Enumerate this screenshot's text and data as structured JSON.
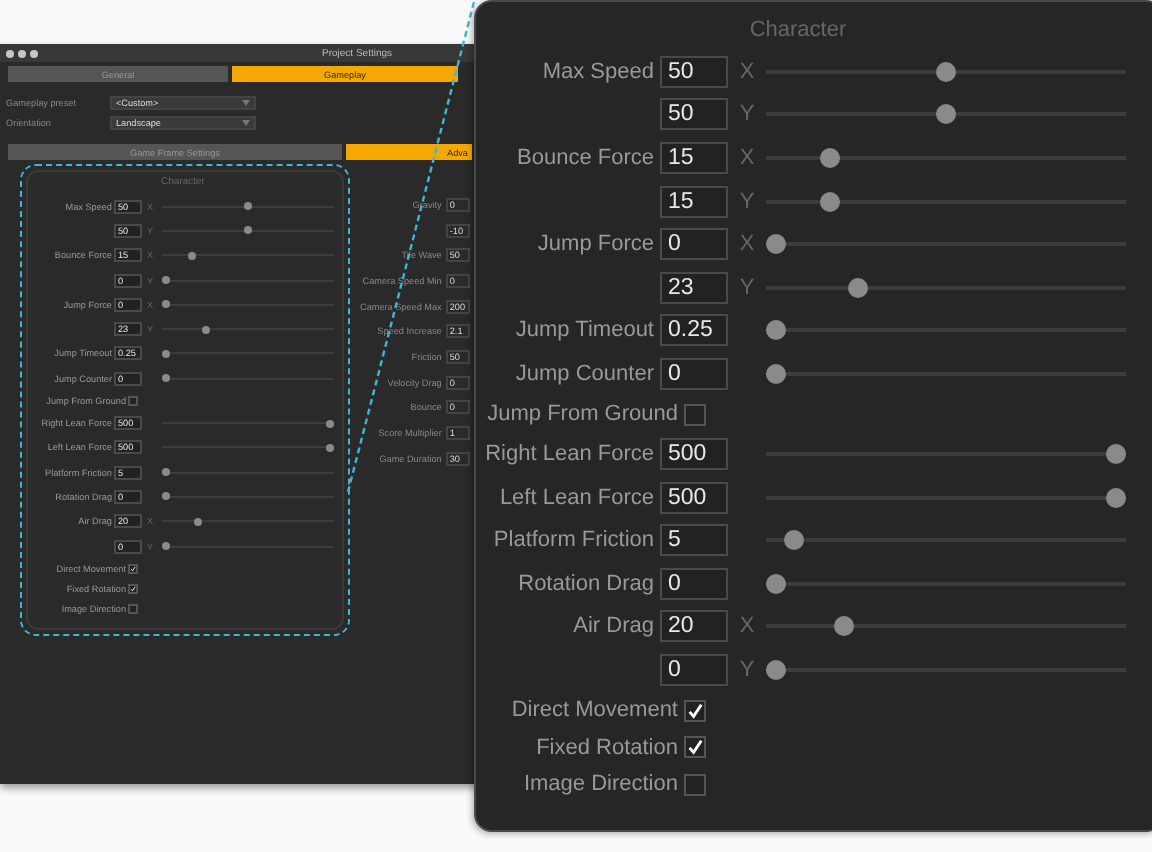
{
  "background_window": {
    "title": "Project Settings",
    "tabs": [
      {
        "label": "General",
        "selected": false
      },
      {
        "label": "Gameplay",
        "selected": true
      }
    ],
    "fields": [
      {
        "label": "Gameplay preset",
        "value": "<Custom>"
      },
      {
        "label": "Orientation",
        "value": "Landscape"
      }
    ],
    "section_tabs": [
      {
        "label": "Game Frame Settings",
        "selected": false
      },
      {
        "label": "Adva",
        "selected": true
      }
    ],
    "character_panel": {
      "title": "Character",
      "rows": [
        {
          "kind": "slider",
          "label": "Max Speed",
          "value": "50",
          "axis": "X",
          "level": 0.5
        },
        {
          "kind": "slider",
          "value": "50",
          "axis": "Y",
          "level": 0.5
        },
        {
          "kind": "slider",
          "label": "Bounce Force",
          "value": "15",
          "axis": "X",
          "level": 0.16
        },
        {
          "kind": "slider",
          "value": "0",
          "axis": "Y",
          "level": 0.0
        },
        {
          "kind": "slider",
          "label": "Jump Force",
          "value": "0",
          "axis": "X",
          "level": 0.0
        },
        {
          "kind": "slider",
          "value": "23",
          "axis": "Y",
          "level": 0.24
        },
        {
          "kind": "slider",
          "label": "Jump Timeout",
          "value": "0.25",
          "level": 0.0
        },
        {
          "kind": "slider",
          "label": "Jump Counter",
          "value": "0",
          "level": 0.0
        },
        {
          "kind": "check",
          "label": "Jump From Ground",
          "checked": false
        },
        {
          "kind": "slider",
          "label": "Right Lean Force",
          "value": "500",
          "level": 1.0
        },
        {
          "kind": "slider",
          "label": "Left Lean Force",
          "value": "500",
          "level": 1.0
        },
        {
          "kind": "slider",
          "label": "Platform Friction",
          "value": "5",
          "level": 0.0
        },
        {
          "kind": "slider",
          "label": "Rotation Drag",
          "value": "0",
          "level": 0.0
        },
        {
          "kind": "slider",
          "label": "Air Drag",
          "value": "20",
          "axis": "X",
          "level": 0.2
        },
        {
          "kind": "slider",
          "value": "0",
          "axis": "Y",
          "level": 0.0
        },
        {
          "kind": "check",
          "label": "Direct Movement",
          "checked": true
        },
        {
          "kind": "check",
          "label": "Fixed Rotation",
          "checked": true
        },
        {
          "kind": "check",
          "label": "Image Direction",
          "checked": false
        }
      ]
    },
    "right_column": [
      {
        "label": "Gravity",
        "value": "0"
      },
      {
        "value": "-10"
      },
      {
        "label": "Tile Wave",
        "value": "50"
      },
      {
        "label": "Camera Speed Min",
        "value": "0"
      },
      {
        "label": "Camera Speed Max",
        "value": "200"
      },
      {
        "label": "Speed Increase",
        "value": "2.1"
      },
      {
        "label": "Friction",
        "value": "50"
      },
      {
        "label": "Velocity Drag",
        "value": "0"
      },
      {
        "label": "Bounce",
        "value": "0"
      },
      {
        "label": "Score Multiplier",
        "value": "1"
      },
      {
        "label": "Game Duration",
        "value": "30"
      }
    ]
  },
  "callout": {
    "title": "Character",
    "rows": [
      {
        "kind": "slider",
        "label": "Max Speed",
        "value": "50",
        "axis": "X",
        "level": 0.5
      },
      {
        "kind": "slider",
        "value": "50",
        "axis": "Y",
        "level": 0.5
      },
      {
        "kind": "slider",
        "label": "Bounce Force",
        "value": "15",
        "axis": "X",
        "level": 0.16
      },
      {
        "kind": "slider",
        "value": "15",
        "axis": "Y",
        "level": 0.16
      },
      {
        "kind": "slider",
        "label": "Jump Force",
        "value": "0",
        "axis": "X",
        "level": 0.0
      },
      {
        "kind": "slider",
        "value": "23",
        "axis": "Y",
        "level": 0.24
      },
      {
        "kind": "slider",
        "label": "Jump Timeout",
        "value": "0.25",
        "level": 0.0
      },
      {
        "kind": "slider",
        "label": "Jump Counter",
        "value": "0",
        "level": 0.0
      },
      {
        "kind": "check",
        "label": "Jump From Ground",
        "checked": false
      },
      {
        "kind": "slider",
        "label": "Right Lean Force",
        "value": "500",
        "level": 1.0
      },
      {
        "kind": "slider",
        "label": "Left Lean Force",
        "value": "500",
        "level": 1.0
      },
      {
        "kind": "slider",
        "label": "Platform Friction",
        "value": "5",
        "level": 0.05
      },
      {
        "kind": "slider",
        "label": "Rotation Drag",
        "value": "0",
        "level": 0.0
      },
      {
        "kind": "slider",
        "label": "Air Drag",
        "value": "20",
        "axis": "X",
        "level": 0.2
      },
      {
        "kind": "slider",
        "value": "0",
        "axis": "Y",
        "level": 0.0
      },
      {
        "kind": "check",
        "label": "Direct Movement",
        "checked": true
      },
      {
        "kind": "check",
        "label": "Fixed Rotation",
        "checked": true
      },
      {
        "kind": "check",
        "label": "Image Direction",
        "checked": false
      }
    ]
  }
}
